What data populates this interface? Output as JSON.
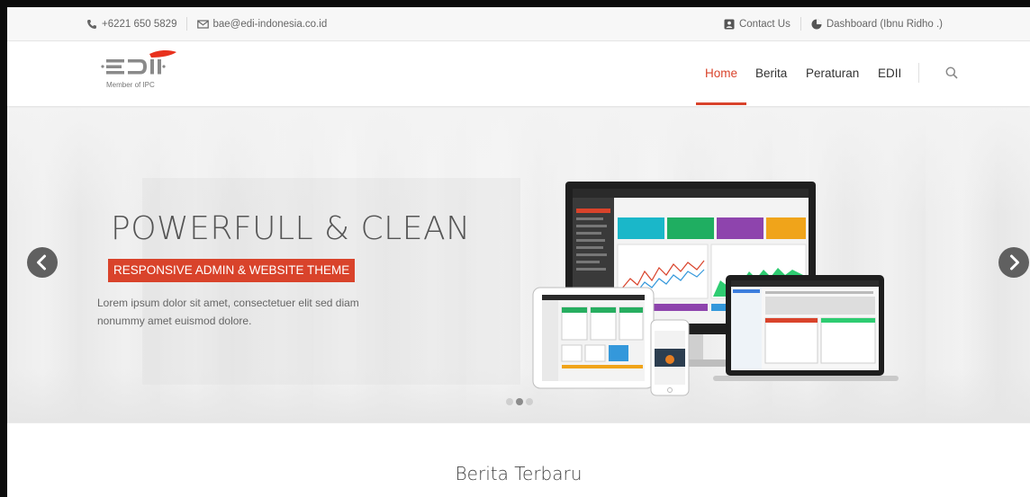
{
  "topbar": {
    "phone": "+6221 650 5829",
    "email": "bae@edi-indonesia.co.id",
    "contact": "Contact Us",
    "dashboard": "Dashboard (Ibnu Ridho .)"
  },
  "logo": {
    "text": "EDII",
    "tagline": "Member of IPC"
  },
  "nav": {
    "items": [
      {
        "label": "Home",
        "active": true
      },
      {
        "label": "Berita",
        "active": false
      },
      {
        "label": "Peraturan",
        "active": false
      },
      {
        "label": "EDII",
        "active": false
      }
    ],
    "search_icon": "search-icon"
  },
  "hero": {
    "headline": "POWERFULL & CLEAN",
    "subheadline": "RESPONSIVE ADMIN & WEBSITE THEME",
    "body": "Lorem ipsum dolor sit amet, consectetuer elit sed diam nonummy amet euismod dolore.",
    "slides": 3,
    "active_slide": 2,
    "prev_icon": "chevron-left-icon",
    "next_icon": "chevron-right-icon"
  },
  "section": {
    "title": "Berita Terbaru"
  },
  "colors": {
    "accent": "#d9432b",
    "topbar_bg": "#f7f7f7",
    "arrow_bg": "#606060"
  }
}
